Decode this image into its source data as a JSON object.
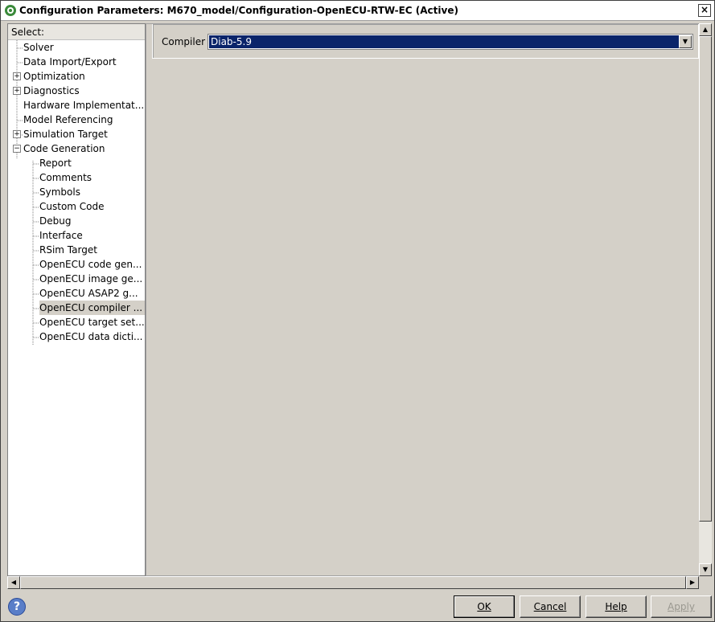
{
  "window": {
    "title": "Configuration Parameters: M670_model/Configuration-OpenECU-RTW-EC (Active)",
    "close_label": "×"
  },
  "tree": {
    "header": "Select:",
    "items": [
      {
        "label": "Solver",
        "level": 0,
        "expander": ""
      },
      {
        "label": "Data Import/Export",
        "level": 0,
        "expander": ""
      },
      {
        "label": "Optimization",
        "level": 0,
        "expander": "+"
      },
      {
        "label": "Diagnostics",
        "level": 0,
        "expander": "+"
      },
      {
        "label": "Hardware Implementat...",
        "level": 0,
        "expander": ""
      },
      {
        "label": "Model Referencing",
        "level": 0,
        "expander": ""
      },
      {
        "label": "Simulation Target",
        "level": 0,
        "expander": "+"
      },
      {
        "label": "Code Generation",
        "level": 0,
        "expander": "−"
      },
      {
        "label": "Report",
        "level": 1,
        "expander": ""
      },
      {
        "label": "Comments",
        "level": 1,
        "expander": ""
      },
      {
        "label": "Symbols",
        "level": 1,
        "expander": ""
      },
      {
        "label": "Custom Code",
        "level": 1,
        "expander": ""
      },
      {
        "label": "Debug",
        "level": 1,
        "expander": ""
      },
      {
        "label": "Interface",
        "level": 1,
        "expander": ""
      },
      {
        "label": "RSim Target",
        "level": 1,
        "expander": ""
      },
      {
        "label": "OpenECU code gen...",
        "level": 1,
        "expander": ""
      },
      {
        "label": "OpenECU image ge...",
        "level": 1,
        "expander": ""
      },
      {
        "label": "OpenECU ASAP2 g...",
        "level": 1,
        "expander": ""
      },
      {
        "label": "OpenECU compiler ...",
        "level": 1,
        "expander": "",
        "selected": true
      },
      {
        "label": "OpenECU target set...",
        "level": 1,
        "expander": ""
      },
      {
        "label": "OpenECU data dicti...",
        "level": 1,
        "expander": ""
      }
    ]
  },
  "compiler": {
    "label": "Compiler",
    "value": "Diab-5.9"
  },
  "buttons": {
    "ok": "OK",
    "cancel": "Cancel",
    "help": "Help",
    "apply": "Apply",
    "help_icon": "?"
  },
  "colors": {
    "selection_blue": "#0a246a",
    "dialog_gray": "#d4d0c8"
  }
}
